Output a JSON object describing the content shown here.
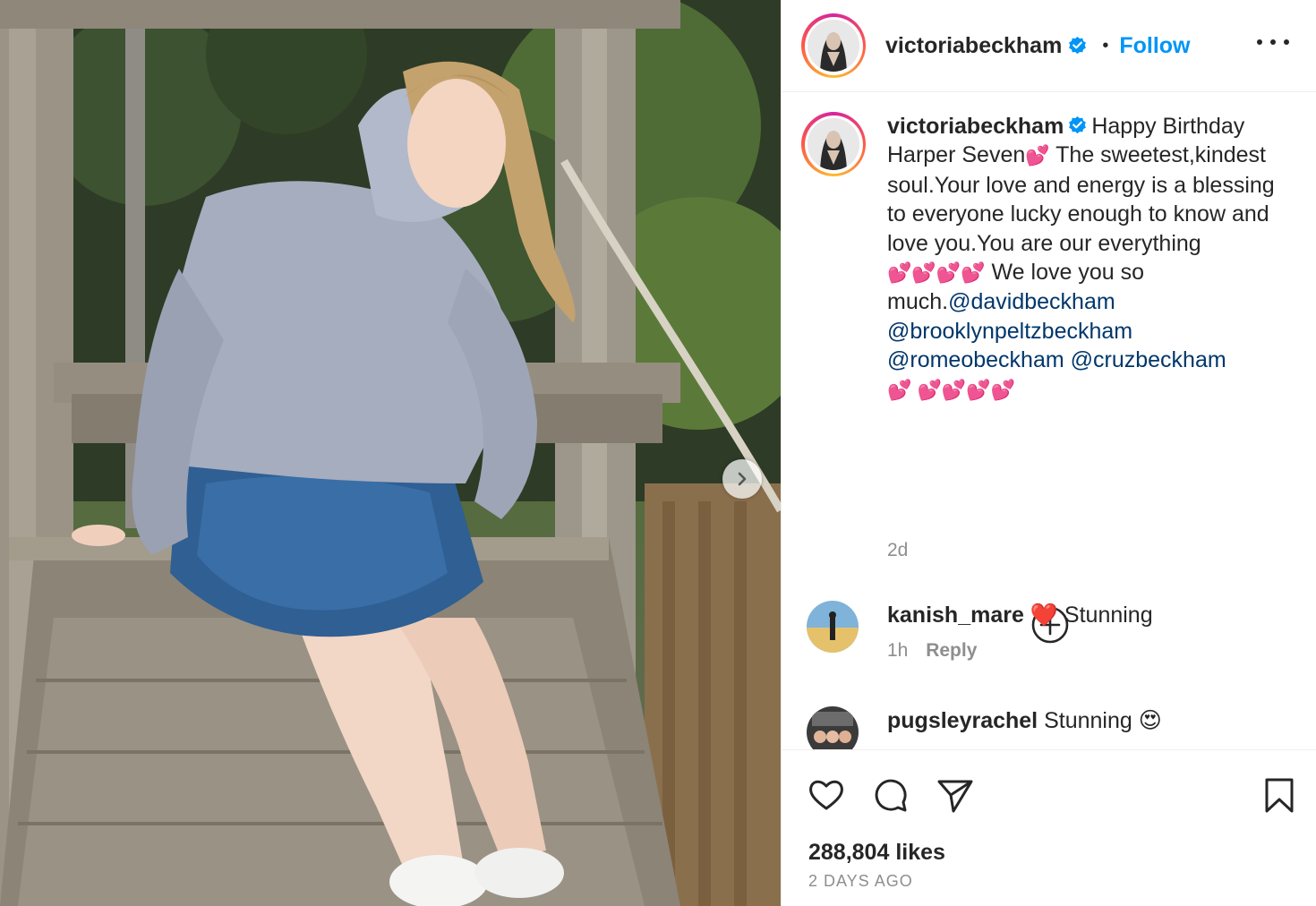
{
  "post": {
    "photo_alt": "",
    "next_icon": "chevron-right-icon"
  },
  "header": {
    "username": "victoriabeckham",
    "separator": "•",
    "follow_label": "Follow",
    "more_icon": "more-options-icon"
  },
  "caption": {
    "username": "victoriabeckham",
    "text_part1": "Happy Birthday Harper Seven",
    "text_part2": " The sweetest,kindest soul.Your love and energy is a blessing to everyone lucky enough to know and love you.You are our everything ",
    "text_part3": " We love you so much.",
    "mentions": [
      "@davidbeckham",
      "@brooklynpeltzbeckham",
      "@romeobeckham",
      "@cruzbeckham"
    ],
    "timestamp": "2d"
  },
  "comments": [
    {
      "username": "kanish_mare",
      "emoji": "❤️",
      "text": "Stunning",
      "time": "1h",
      "reply_label": "Reply"
    },
    {
      "username": "pugsleyrachel",
      "text": "Stunning",
      "emoji": "😍"
    }
  ],
  "actions": {
    "likes": "288,804 likes",
    "date": "2 DAYS AGO"
  },
  "colors": {
    "link": "#0095f6",
    "mention": "#00376b",
    "muted": "#8e8e8e",
    "heart_emoji": "#ff3ca6"
  }
}
